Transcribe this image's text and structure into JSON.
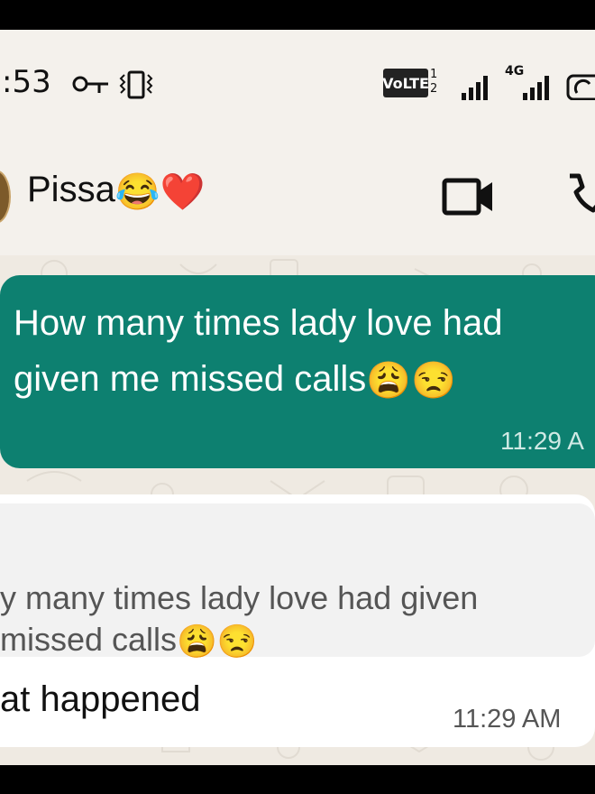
{
  "status_bar": {
    "time": ":53",
    "volte_label": "VoLTE",
    "sim_index_top": "1",
    "sim_index_bottom": "2",
    "network_label": "4G"
  },
  "header": {
    "contact_name": "Pissa",
    "contact_emojis": [
      "😂",
      "❤️"
    ]
  },
  "messages": [
    {
      "direction": "outgoing",
      "text_line1": "How many times lady love had",
      "text_line2": "given me missed calls",
      "emojis": [
        "😩",
        "😒"
      ],
      "time": "11:29 A"
    },
    {
      "direction": "incoming",
      "quoted_line1": "y many times lady love had given",
      "quoted_line2": "missed calls",
      "quoted_emojis": [
        "😩",
        "😒"
      ],
      "text": "at happened",
      "time": "11:29 AM"
    }
  ],
  "colors": {
    "outgoing_bubble": "#0d8070",
    "chat_background": "#efeae2",
    "header_background": "#f4f1ec"
  }
}
